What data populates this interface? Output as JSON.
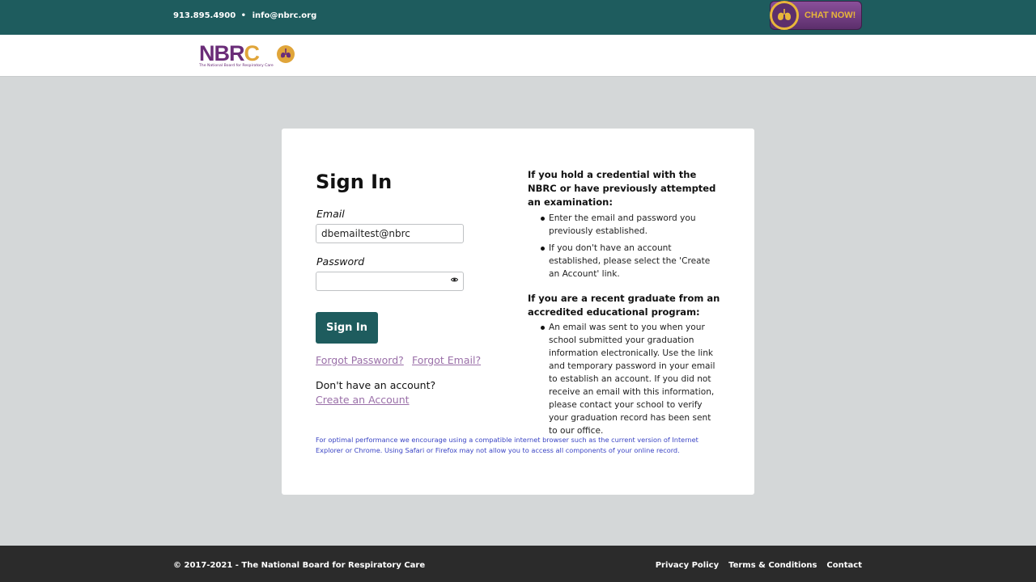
{
  "topbar": {
    "phone": "913.895.4900",
    "separator": "•",
    "email": "info@nbrc.org",
    "chat_label": "CHAT NOW!",
    "chat_icon": "lungs-icon"
  },
  "header": {
    "logo_text_nbr": "NBR",
    "logo_text_c": "C",
    "logo_tagline": "The National Board for Respiratory Care"
  },
  "signin": {
    "title": "Sign In",
    "email_label": "Email",
    "email_value": "dbemailtest@nbrc",
    "password_label": "Password",
    "password_value": "",
    "button_label": "Sign In",
    "forgot_password": "Forgot Password?",
    "forgot_email": "Forgot Email?",
    "no_account": "Don't have an account?",
    "create_account": "Create an Account"
  },
  "info": {
    "heading1": "If you hold a credential with the NBRC or have previously attempted an examination:",
    "items1": [
      "Enter the email and password you previously established.",
      "If you don't have an account established, please select the 'Create an Account' link."
    ],
    "heading2": "If you are a recent graduate from an accredited educational program:",
    "items2": [
      "An email was sent to you when your school submitted your graduation information electronically. Use the link and temporary password in your email to establish an account. If you did not receive an email with this information, please contact your school to verify your graduation record has been sent to our office."
    ]
  },
  "notice": "For optimal performance we encourage using a compatible internet browser such as the current version of Internet Explorer or Chrome. Using Safari or Firefox may not allow you to access all components of your online record.",
  "footer": {
    "copyright": "© 2017-2021 - The National Board for Respiratory Care",
    "links": [
      "Privacy Policy",
      "Terms & Conditions",
      "Contact"
    ]
  },
  "colors": {
    "teal": "#1e5c5e",
    "purple": "#6a2c78",
    "gold": "#e0a53a",
    "link": "#9a6fa8",
    "notice": "#3a44c4"
  }
}
